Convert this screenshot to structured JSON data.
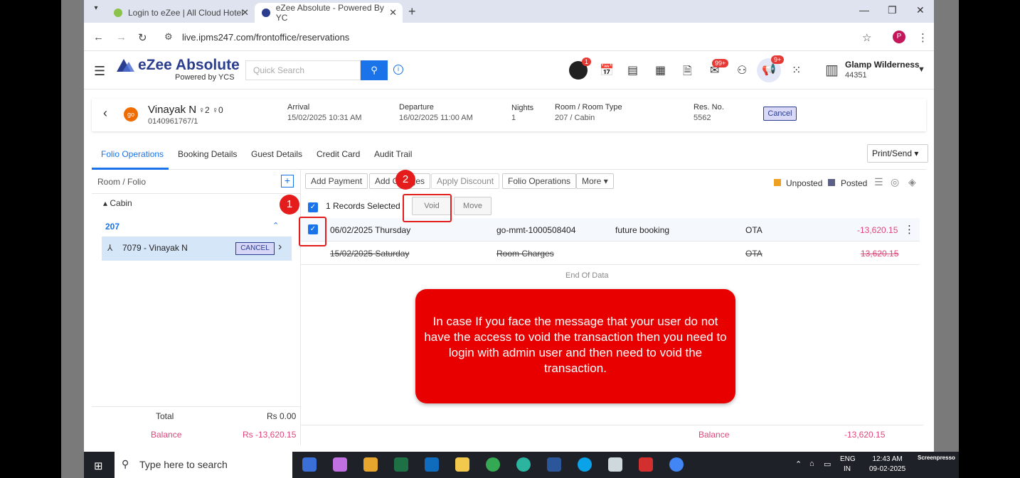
{
  "browser": {
    "tabs": [
      {
        "title": "Login to eZee | All Cloud Hotel"
      },
      {
        "title": "eZee Absolute - Powered By YC"
      }
    ],
    "url": "live.ipms247.com/frontoffice/reservations",
    "profile_initial": "P"
  },
  "app": {
    "logo_title": "eZee Absolute",
    "logo_sub": "Powered by YCS",
    "search_placeholder": "Quick Search",
    "badges": {
      "notify": "1",
      "mail": "99+",
      "announce": "9+"
    },
    "hotel_name": "Glamp Wilderness",
    "hotel_id": "44351"
  },
  "reservation": {
    "guest_initials": "go",
    "guest_name": "Vinayak N",
    "adults": "2",
    "children": "0",
    "phone": "0140961767/1",
    "arrival_label": "Arrival",
    "arrival": "15/02/2025 10:31 AM",
    "departure_label": "Departure",
    "departure": "16/02/2025 11:00 AM",
    "nights_label": "Nights",
    "nights": "1",
    "room_label": "Room / Room Type",
    "room": "207 / Cabin",
    "resno_label": "Res. No.",
    "resno": "5562",
    "cancel_label": "Cancel"
  },
  "tabs": [
    "Folio Operations",
    "Booking Details",
    "Guest Details",
    "Credit Card",
    "Audit Trail"
  ],
  "print_label": "Print/Send",
  "folio": {
    "title": "Room / Folio",
    "room_type": "Cabin",
    "room_no": "207",
    "item": "7079 - Vinayak N",
    "item_badge": "CANCEL",
    "total_label": "Total",
    "total_value": "Rs 0.00",
    "balance_label": "Balance",
    "balance_value": "Rs -13,620.15"
  },
  "toolbar": {
    "add_payment": "Add Payment",
    "add_charges": "Add Charges",
    "apply_discount": "Apply Discount",
    "folio_operations": "Folio Operations",
    "more": "More",
    "unposted": "Unposted",
    "posted": "Posted"
  },
  "selection": {
    "label": "1 Records Selected",
    "void": "Void",
    "move": "Move"
  },
  "rows": [
    {
      "date": "06/02/2025 Thursday",
      "ref": "go-mmt-1000508404",
      "desc": "future booking",
      "user": "OTA",
      "amount": "-13,620.15"
    },
    {
      "date": "15/02/2025 Saturday",
      "ref": "Room Charges",
      "desc": "",
      "user": "OTA",
      "amount": "13,620.15"
    }
  ],
  "end_of_data": "End Of Data",
  "footer": {
    "balance_label": "Balance",
    "balance_value": "-13,620.15"
  },
  "annotations": {
    "step1": "1",
    "step2": "2",
    "callout": "In case If you face the message that your user do not have the access to void the transaction then you need to login with admin user and then need to void the transaction."
  },
  "taskbar": {
    "search_placeholder": "Type here to search",
    "lang1": "ENG",
    "lang2": "IN",
    "time": "12:43 AM",
    "date": "09-02-2025"
  },
  "watermark": "Screenpresso"
}
